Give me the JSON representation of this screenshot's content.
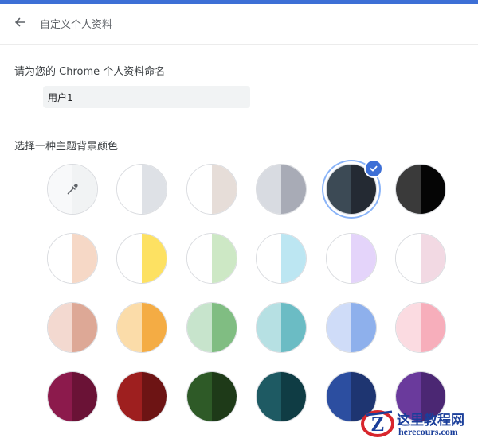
{
  "header": {
    "title": "自定义个人资料"
  },
  "profile": {
    "name_label": "请为您的 Chrome 个人资料命名",
    "name_value": "用户1"
  },
  "theme": {
    "label": "选择一种主题背景颜色",
    "selected_index": 4,
    "swatches": [
      {
        "left": "#f8f9fa",
        "right": "#f1f3f4",
        "kind": "color-picker",
        "icon": "eyedropper-icon"
      },
      {
        "left": "#ffffff",
        "right": "#dee1e6"
      },
      {
        "left": "#ffffff",
        "right": "#e6ddd8"
      },
      {
        "left": "#d8dbe1",
        "right": "#a8abb6"
      },
      {
        "left": "#3c4a55",
        "right": "#242a33"
      },
      {
        "left": "#3a3a3a",
        "right": "#050505"
      },
      {
        "left": "#ffffff",
        "right": "#f6d8c6"
      },
      {
        "left": "#ffffff",
        "right": "#fde162"
      },
      {
        "left": "#ffffff",
        "right": "#cde8c5"
      },
      {
        "left": "#ffffff",
        "right": "#bce6f2"
      },
      {
        "left": "#ffffff",
        "right": "#e4d4fa"
      },
      {
        "left": "#ffffff",
        "right": "#f2d9e3"
      },
      {
        "left": "#f3d9d0",
        "right": "#dda896"
      },
      {
        "left": "#fbdca9",
        "right": "#f4ac44"
      },
      {
        "left": "#c7e4cc",
        "right": "#80bd82"
      },
      {
        "left": "#b6e0e3",
        "right": "#6bbcc4"
      },
      {
        "left": "#cfdcf8",
        "right": "#8eb0ec"
      },
      {
        "left": "#fbdbe1",
        "right": "#f7aebb"
      },
      {
        "left": "#8c1a4c",
        "right": "#6a1236"
      },
      {
        "left": "#9e1f1f",
        "right": "#6d1414"
      },
      {
        "left": "#2e5a27",
        "right": "#1e3a18"
      },
      {
        "left": "#1e5a63",
        "right": "#0f3c44"
      },
      {
        "left": "#2c4ea0",
        "right": "#1e3571"
      },
      {
        "left": "#6a3a9c",
        "right": "#4b2773"
      }
    ]
  },
  "watermark": {
    "title": "这里教程网",
    "url": "herecours.com",
    "logo_letter": "Z",
    "accent": "#1a3e9a",
    "logo_red": "#d8262d"
  },
  "colors": {
    "accent": "#3d6fd6",
    "selected_ring": "#8ab4f8"
  }
}
